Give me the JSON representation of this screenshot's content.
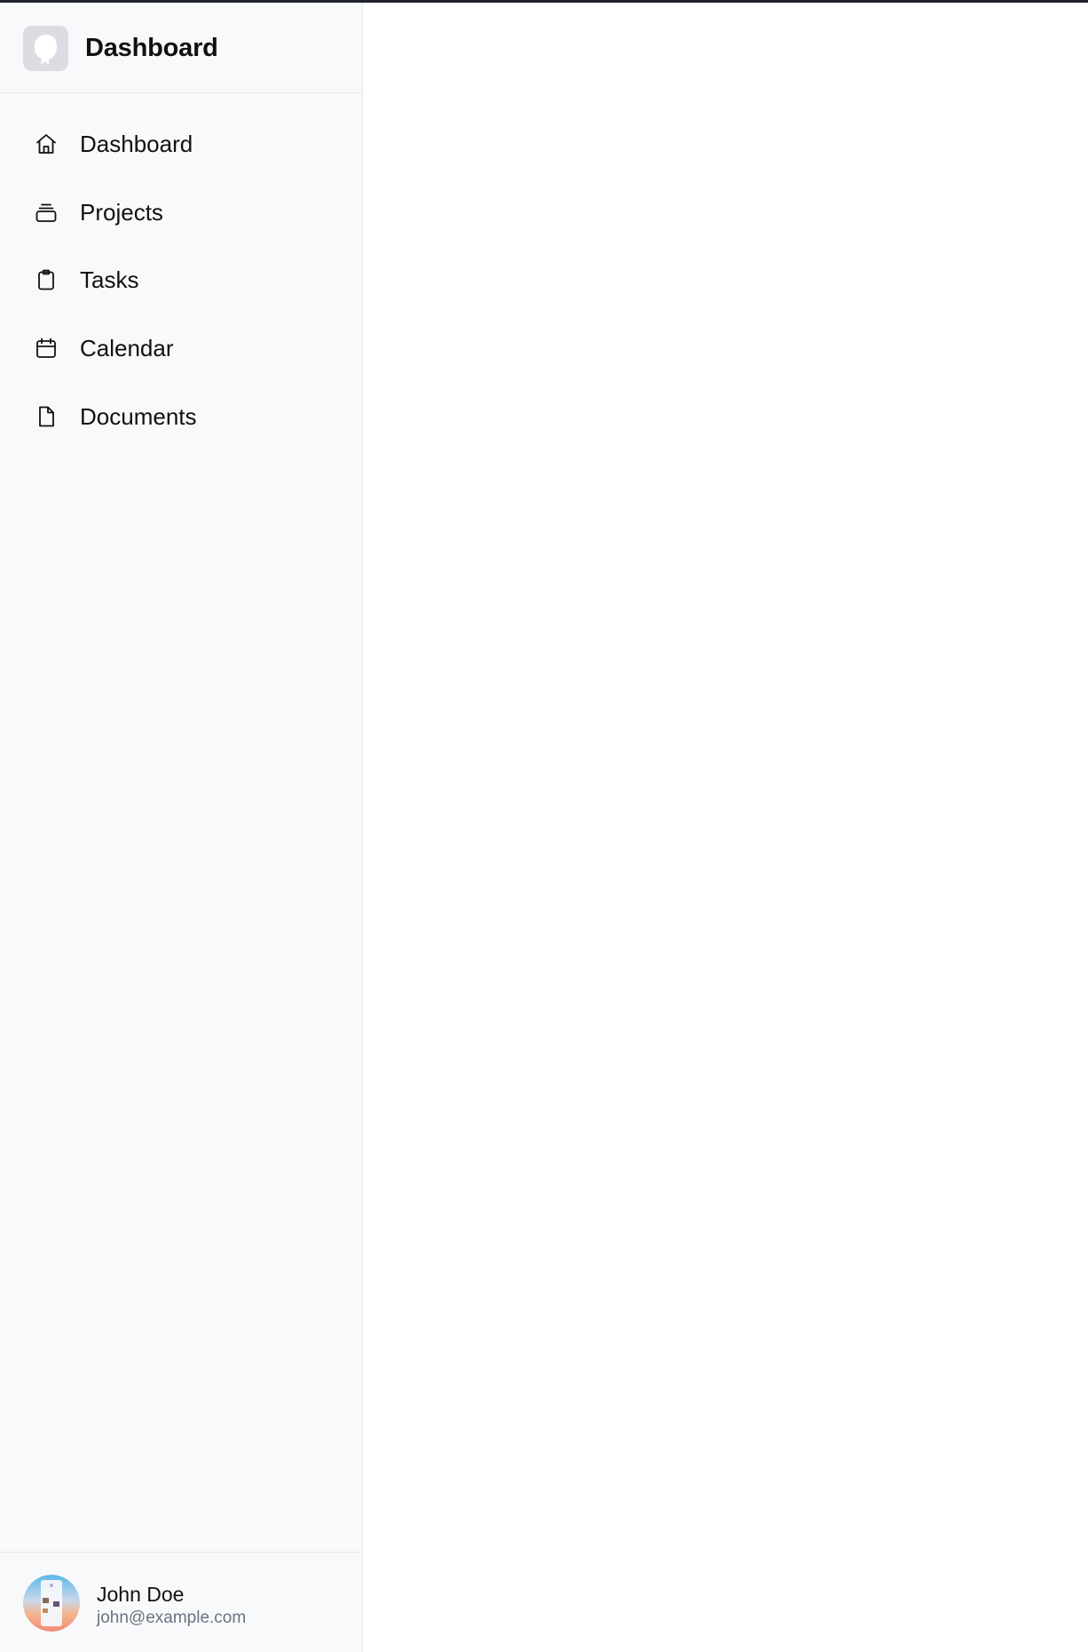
{
  "brand": {
    "title": "Dashboard",
    "logo_icon": "app-logo-icon"
  },
  "nav": {
    "items": [
      {
        "label": "Dashboard",
        "icon": "home-icon"
      },
      {
        "label": "Projects",
        "icon": "stack-icon"
      },
      {
        "label": "Tasks",
        "icon": "clipboard-icon"
      },
      {
        "label": "Calendar",
        "icon": "calendar-icon"
      },
      {
        "label": "Documents",
        "icon": "document-icon"
      }
    ]
  },
  "user": {
    "name": "John Doe",
    "email": "john@example.com",
    "avatar_icon": "avatar-image"
  },
  "colors": {
    "sidebar_bg": "#f8f9fb",
    "main_bg": "#ffffff",
    "text_primary": "#111111",
    "text_secondary": "#6b7280",
    "border": "#e5e7eb"
  }
}
